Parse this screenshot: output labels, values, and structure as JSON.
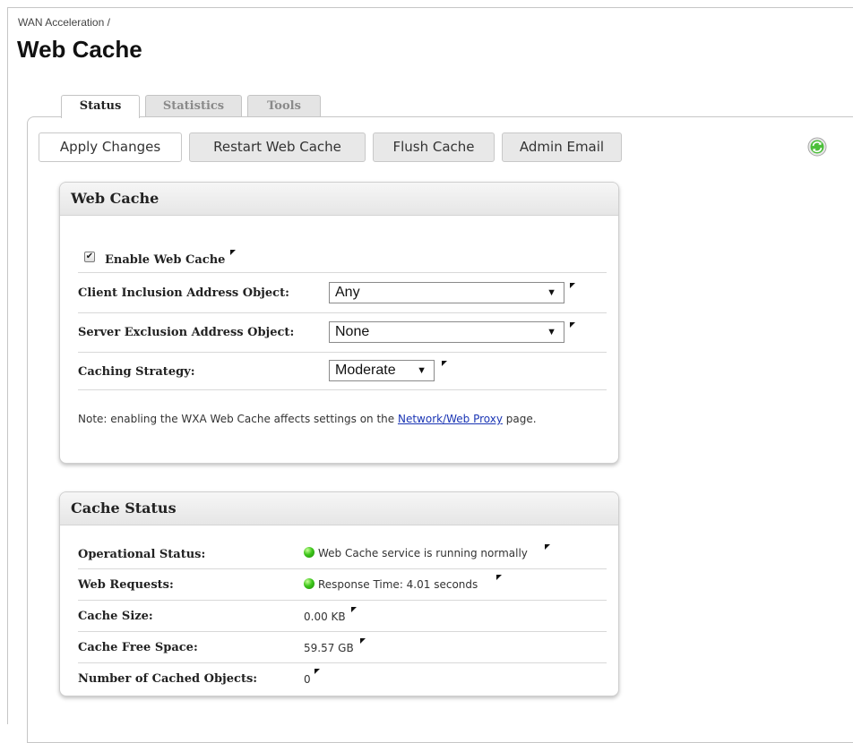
{
  "breadcrumb": "WAN Acceleration /",
  "title": "Web Cache",
  "tabs": [
    {
      "label": "Status",
      "active": true
    },
    {
      "label": "Statistics",
      "active": false
    },
    {
      "label": "Tools",
      "active": false
    }
  ],
  "toolbar": {
    "apply": "Apply Changes",
    "restart": "Restart Web Cache",
    "flush": "Flush Cache",
    "admin_email": "Admin Email",
    "refresh_icon": "refresh-icon"
  },
  "web_cache": {
    "heading": "Web Cache",
    "enable_label": "Enable Web Cache",
    "enable_checked": true,
    "client_label": "Client Inclusion Address Object:",
    "client_value": "Any",
    "server_label": "Server Exclusion Address Object:",
    "server_value": "None",
    "strategy_label": "Caching Strategy:",
    "strategy_value": "Moderate",
    "note_prefix": "Note: enabling the WXA Web Cache affects settings on the ",
    "note_link": "Network/Web Proxy",
    "note_suffix": " page."
  },
  "cache_status": {
    "heading": "Cache Status",
    "rows": [
      {
        "label": "Operational Status:",
        "value": "Web Cache service is running normally",
        "led": "green"
      },
      {
        "label": "Web Requests:",
        "value": "Response Time: 4.01 seconds",
        "led": "green"
      },
      {
        "label": "Cache Size:",
        "value": "0.00 KB"
      },
      {
        "label": "Cache Free Space:",
        "value": "59.57 GB"
      },
      {
        "label": "Number of Cached Objects:",
        "value": "0"
      }
    ]
  },
  "colors": {
    "link": "#1a35b4",
    "status_green": "#3ec61b"
  }
}
